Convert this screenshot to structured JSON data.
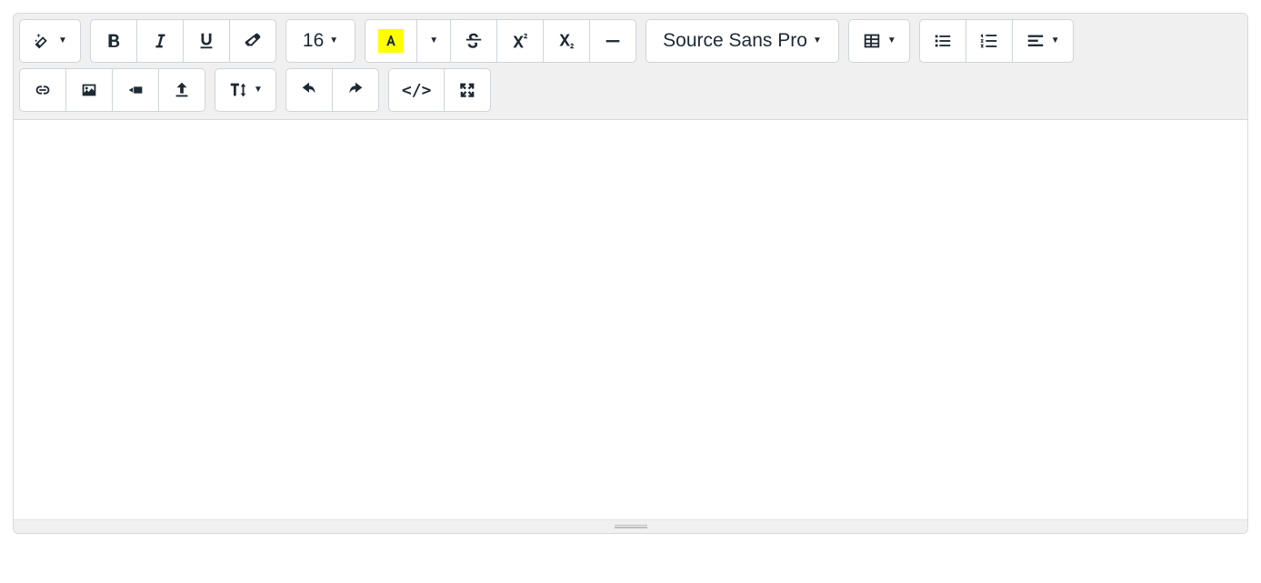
{
  "toolbar": {
    "font_size": "16",
    "font_family": "Source Sans Pro",
    "codeview_label": "</>"
  }
}
